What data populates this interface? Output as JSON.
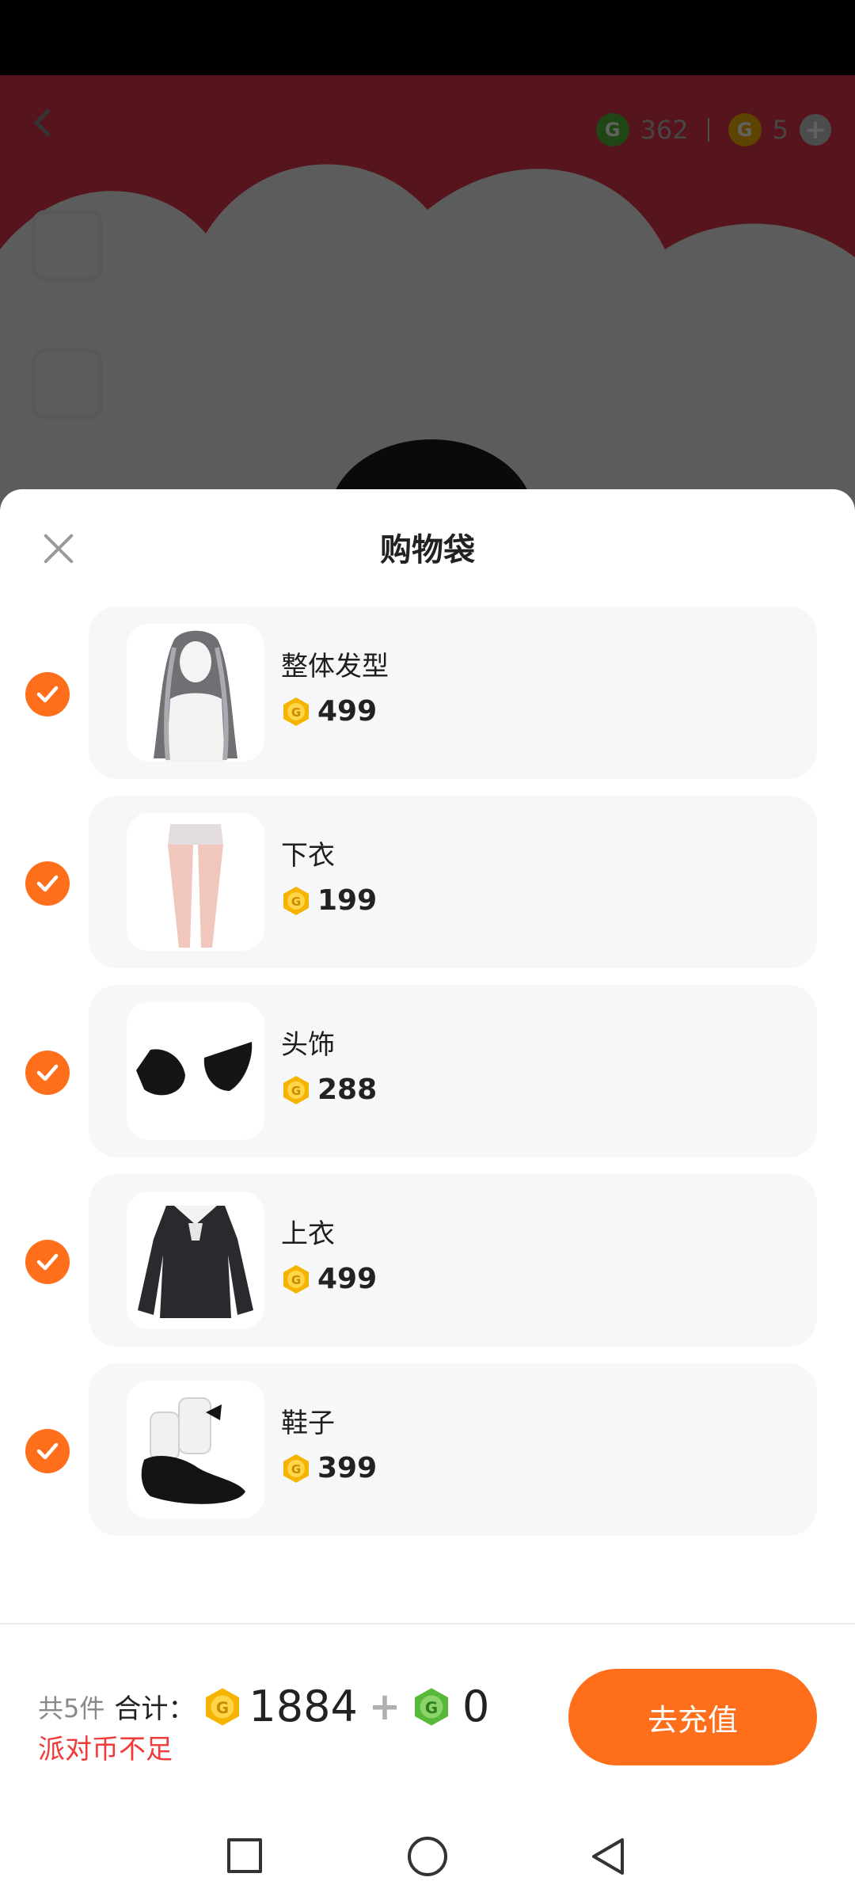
{
  "background": {
    "currency_green": "362",
    "currency_gold": "5"
  },
  "sheet": {
    "title": "购物袋",
    "items": [
      {
        "name": "整体发型",
        "price": "499",
        "checked": true,
        "icon": "hair-image"
      },
      {
        "name": "下衣",
        "price": "199",
        "checked": true,
        "icon": "leggings-image"
      },
      {
        "name": "头饰",
        "price": "288",
        "checked": true,
        "icon": "ears-image"
      },
      {
        "name": "上衣",
        "price": "499",
        "checked": true,
        "icon": "dress-image"
      },
      {
        "name": "鞋子",
        "price": "399",
        "checked": true,
        "icon": "shoes-image"
      }
    ]
  },
  "footer": {
    "count": "共5件",
    "total_label": "合计：",
    "total_gold": "1884",
    "plus": "+",
    "total_green": "0",
    "warning": "派对币不足",
    "recharge_button": "去充值"
  },
  "colors": {
    "accent": "#ff6e1a",
    "warning": "#f03b3b",
    "gold_coin": "#f4b400",
    "green_coin": "#57b83a"
  }
}
